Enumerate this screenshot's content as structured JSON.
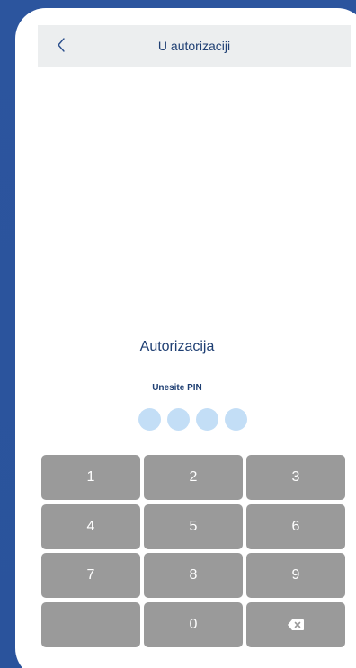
{
  "nav": {
    "back_icon": "chevron-left-icon",
    "title": "U autorizaciji"
  },
  "auth": {
    "title": "Autorizacija",
    "pin_label": "Unesite PIN",
    "pin_length": 4,
    "pin_entered": 0
  },
  "keypad": {
    "keys": [
      "1",
      "2",
      "3",
      "4",
      "5",
      "6",
      "7",
      "8",
      "9",
      "",
      "0",
      "backspace"
    ]
  },
  "colors": {
    "background": "#2c559e",
    "navbar": "#eceeef",
    "text": "#1f3f73",
    "pin_dot": "#c3def6",
    "key": "#9a9a9a"
  }
}
